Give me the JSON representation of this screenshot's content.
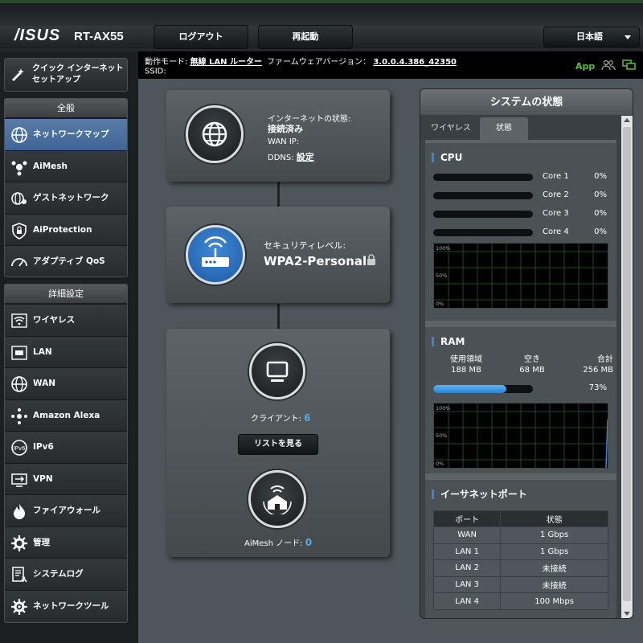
{
  "header": {
    "brand": "/ISUS",
    "model": "RT-AX55",
    "logout_label": "ログアウト",
    "reboot_label": "再起動",
    "language": "日本語"
  },
  "info": {
    "mode_label": "動作モード:",
    "mode_value": "無線 LAN ルーター",
    "firmware_label": "ファームウェアバージョン：",
    "firmware_value": "3.0.0.4.386_42350",
    "ssid_label": "SSID:",
    "app_label": "App"
  },
  "sidebar": {
    "quick_setup": "クイック インターネット セットアップ",
    "general_head": "全般",
    "general_items": [
      {
        "label": "ネットワークマップ",
        "icon": "globe-network-icon"
      },
      {
        "label": "AiMesh",
        "icon": "aimesh-icon"
      },
      {
        "label": "ゲストネットワーク",
        "icon": "guest-network-icon"
      },
      {
        "label": "AiProtection",
        "icon": "shield-lock-icon"
      },
      {
        "label": "アダプティブ QoS",
        "icon": "gauge-icon"
      }
    ],
    "advanced_head": "詳細設定",
    "advanced_items": [
      {
        "label": "ワイヤレス",
        "icon": "wifi-icon"
      },
      {
        "label": "LAN",
        "icon": "lan-icon"
      },
      {
        "label": "WAN",
        "icon": "wan-globe-icon"
      },
      {
        "label": "Amazon Alexa",
        "icon": "alexa-icon"
      },
      {
        "label": "IPv6",
        "icon": "ipv6-icon"
      },
      {
        "label": "VPN",
        "icon": "vpn-icon"
      },
      {
        "label": "ファイアウォール",
        "icon": "fire-icon"
      },
      {
        "label": "管理",
        "icon": "admin-gear-icon"
      },
      {
        "label": "システムログ",
        "icon": "system-log-icon"
      },
      {
        "label": "ネットワークツール",
        "icon": "tools-gear-icon"
      }
    ]
  },
  "map": {
    "internet_status_label": "インターネットの状態:",
    "internet_status_value": "接続済み",
    "wan_ip_label": "WAN IP:",
    "ddns_label": "DDNS:",
    "ddns_value": "設定",
    "security_label": "セキュリティレベル:",
    "security_value": "WPA2-Personal",
    "clients_label": "クライアント:",
    "clients_count": "6",
    "view_list": "リストを見る",
    "aimesh_label": "AiMesh ノード:",
    "aimesh_count": "0"
  },
  "system": {
    "title": "システムの状態",
    "tab_wireless": "ワイヤレス",
    "tab_status": "状態",
    "cpu_head": "CPU",
    "cores": [
      {
        "label": "Core 1",
        "value": "0%"
      },
      {
        "label": "Core 2",
        "value": "0%"
      },
      {
        "label": "Core 3",
        "value": "0%"
      },
      {
        "label": "Core 4",
        "value": "0%"
      }
    ],
    "graph_labels": [
      "100%",
      "50%",
      "0%"
    ],
    "ram_head": "RAM",
    "ram_used_label": "使用領域",
    "ram_used": "188 MB",
    "ram_free_label": "空き",
    "ram_free": "68 MB",
    "ram_total_label": "合計",
    "ram_total": "256 MB",
    "ram_pct": "73%",
    "ram_fraction": 0.73,
    "eth_head": "イーサネットポート",
    "eth_columns": [
      "ポート",
      "状態"
    ],
    "eth_rows": [
      {
        "port": "WAN",
        "status": "1 Gbps"
      },
      {
        "port": "LAN 1",
        "status": "1 Gbps"
      },
      {
        "port": "LAN 2",
        "status": "未接続"
      },
      {
        "port": "LAN 3",
        "status": "未接続"
      },
      {
        "port": "LAN 4",
        "status": "100 Mbps"
      }
    ]
  },
  "colors": {
    "accent_blue": "#3f83d6",
    "active_nav": "#4b72a1",
    "app_green": "#59c03a",
    "count_blue": "#5aa7e6"
  }
}
